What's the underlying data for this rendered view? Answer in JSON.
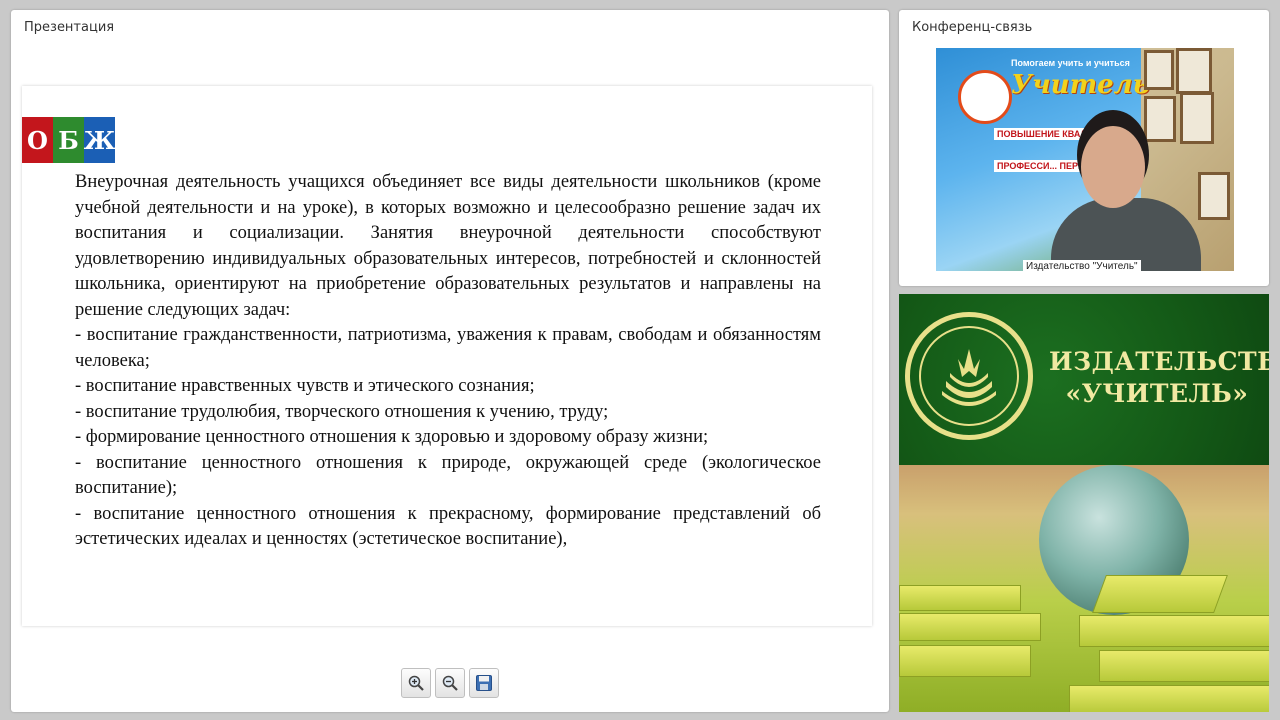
{
  "presentation": {
    "title": "Презентация",
    "logo": {
      "letters": [
        "О",
        "Б",
        "Ж"
      ],
      "colors": [
        "#c3161c",
        "#2e8b2e",
        "#1b5fb5"
      ]
    },
    "paragraphs": [
      "Внеурочная деятельность учащихся объединяет все виды деятельности школьников (кроме учебной деятельности и на уроке), в которых возможно и целесообразно решение задач их воспитания и социализации. Занятия внеурочной деятельности способствуют удовлетворению индивидуальных образовательных интересов, потребностей и склонностей школьника, ориентируют на приобретение образовательных результатов и направлены на решение следующих задач:",
      "- воспитание гражданственности, патриотизма, уважения к правам, свободам и обязанностям человека;",
      "- воспитание нравственных чувств и этического сознания;",
      "- воспитание трудолюбия, творческого отношения к учению, труду;",
      "- формирование ценностного отношения к здоровью и здоровому образу жизни;",
      "- воспитание ценностного отношения к природе, окружающей среде (экологическое воспитание);",
      "- воспитание ценностного отношения к прекрасному, формирование представлений об эстетических идеалах и ценностях (эстетическое воспитание),"
    ],
    "toolbar": [
      {
        "name": "zoom-in-button",
        "icon": "zoom-in-icon"
      },
      {
        "name": "zoom-out-button",
        "icon": "zoom-out-icon"
      },
      {
        "name": "save-button",
        "icon": "floppy-disk-icon"
      }
    ]
  },
  "conference": {
    "title": "Конференц-связь",
    "video": {
      "caption": "Издательство \"Учитель\"",
      "banner_top": "Помогаем учить и учиться",
      "banner_name": "Учитель",
      "banner_lines": [
        "ПОВЫШЕНИЕ КВАЛИФИ...",
        "ПРОФЕССИ... ПЕРЕПОД..."
      ]
    }
  },
  "publisher": {
    "name_line1": "ИЗДАТЕЛЬСТВО",
    "name_line2": "«УЧИТЕЛЬ»",
    "colors": {
      "green": "#145a17",
      "gold": "#f1e9a2"
    }
  }
}
